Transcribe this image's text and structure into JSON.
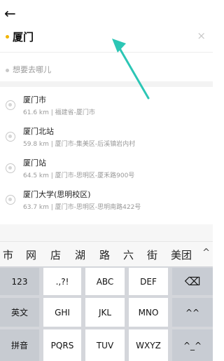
{
  "topbar": {
    "back_icon": "back-arrow-icon",
    "back_glyph": "←"
  },
  "from_field": {
    "value": "厦门",
    "clear_glyph": "×"
  },
  "to_field": {
    "placeholder": "想要去哪儿"
  },
  "suggestions": [
    {
      "title": "厦门市",
      "subtitle": "61.6 km | 福建省-厦门市"
    },
    {
      "title": "厦门北站",
      "subtitle": "59.8 km | 厦门市-集美区-后溪镇岩内村"
    },
    {
      "title": "厦门站",
      "subtitle": "64.5 km | 厦门市-思明区-厦禾路900号"
    },
    {
      "title": "厦门大学(思明校区)",
      "subtitle": "63.7 km | 厦门市-思明区-思明南路422号"
    }
  ],
  "candidates": [
    "市",
    "网",
    "店",
    "湖",
    "路",
    "六",
    "街",
    "美团"
  ],
  "candidates_more": "^",
  "keyboard": {
    "left_col": [
      "123",
      "英文",
      "拼音"
    ],
    "row1": [
      ".,?!",
      "ABC",
      "DEF"
    ],
    "row2": [
      "GHI",
      "JKL",
      "MNO"
    ],
    "row3": [
      "PQRS",
      "TUV",
      "WXYZ"
    ],
    "right_col_1": "⌫",
    "right_col_2": "^^",
    "right_col_3": "^_^"
  },
  "colors": {
    "accent_dot": "#f2b400",
    "annotation_arrow": "#2cc6b5"
  }
}
